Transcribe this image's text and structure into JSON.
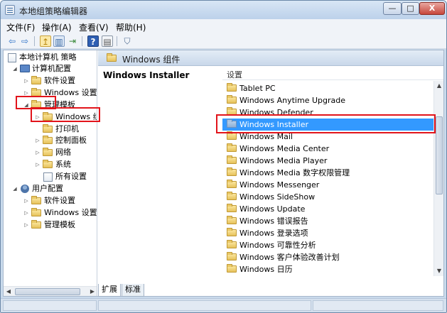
{
  "window": {
    "title": "本地组策略编辑器"
  },
  "controls": {
    "minimize": "—",
    "maximize": "□",
    "close": "X"
  },
  "menu": [
    {
      "label": "文件(F)"
    },
    {
      "label": "操作(A)"
    },
    {
      "label": "查看(V)"
    },
    {
      "label": "帮助(H)"
    }
  ],
  "toolbar": {
    "back": "⇦",
    "forward": "⇨",
    "up": "↥",
    "show_tree": "▥",
    "export": "⇥",
    "help": "?",
    "properties": "▤",
    "filter": "⛉"
  },
  "tree": {
    "root": "本地计算机 策略",
    "computer_config": "计算机配置",
    "cc_software": "软件设置",
    "cc_windows": "Windows 设置",
    "cc_admin": "管理模板",
    "cc_admin_windows": "Windows 组",
    "cc_admin_printers": "打印机",
    "cc_admin_control_panel": "控制面板",
    "cc_admin_network": "网络",
    "cc_admin_system": "系统",
    "cc_admin_all": "所有设置",
    "user_config": "用户配置",
    "uc_software": "软件设置",
    "uc_windows": "Windows 设置",
    "uc_admin": "管理模板"
  },
  "breadcrumb": "Windows 组件",
  "description_title": "Windows Installer",
  "list": {
    "header": "设置",
    "selected_index": 3,
    "items": [
      "Tablet PC",
      "Windows Anytime Upgrade",
      "Windows Defender",
      "Windows Installer",
      "Windows Mail",
      "Windows Media Center",
      "Windows Media Player",
      "Windows Media 数字权限管理",
      "Windows Messenger",
      "Windows SideShow",
      "Windows Update",
      "Windows 错误报告",
      "Windows 登录选项",
      "Windows 可靠性分析",
      "Windows 客户体验改善计划",
      "Windows 日历"
    ]
  },
  "tabs": {
    "extended": "扩展",
    "standard": "标准"
  },
  "scroll": {
    "up": "▲",
    "down": "▼",
    "left": "◀",
    "right": "▶"
  },
  "colors": {
    "highlight": "#e2141b",
    "selection": "#3399ff"
  }
}
